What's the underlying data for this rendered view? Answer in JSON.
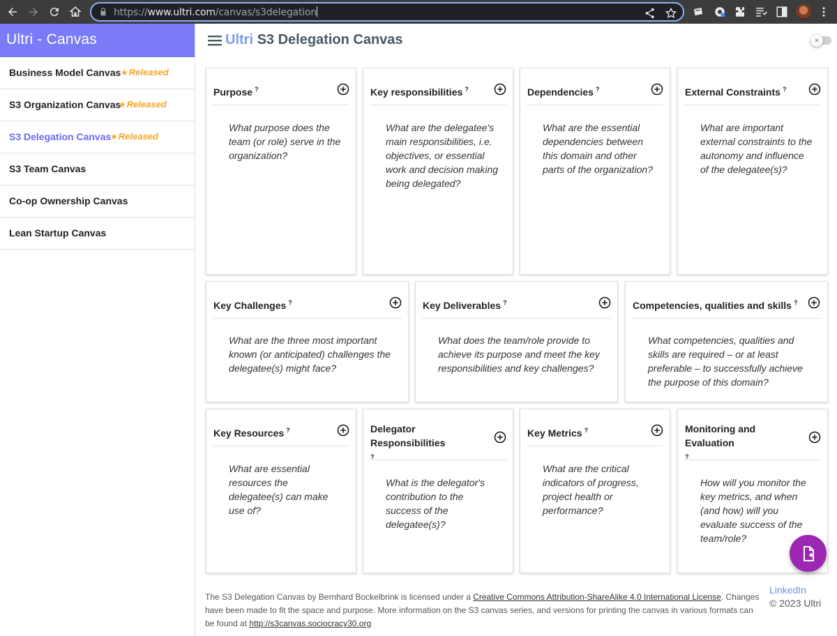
{
  "browser": {
    "url_scheme": "https://",
    "url_host": "www.ultri.com",
    "url_path": "/canvas/s3delegation"
  },
  "sidebar": {
    "title": "Ultri - Canvas",
    "items": [
      {
        "label": "Business Model Canvas",
        "badge": "Released"
      },
      {
        "label": "S3 Organization Canvas",
        "badge": "Released"
      },
      {
        "label": "S3 Delegation Canvas",
        "badge": "Released",
        "active": true
      },
      {
        "label": "S3 Team Canvas",
        "badge": ""
      },
      {
        "label": "Co-op Ownership Canvas",
        "badge": ""
      },
      {
        "label": "Lean Startup Canvas",
        "badge": ""
      }
    ]
  },
  "header": {
    "brand": "Ultri",
    "title": "S3 Delegation Canvas"
  },
  "cards": {
    "purpose": {
      "title": "Purpose",
      "hint": "?",
      "text": "What purpose does the team (or role) serve in the organization?"
    },
    "key_responsibilities": {
      "title": "Key responsibilities",
      "hint": "?",
      "text": "What are the delegatee's main responsibilities, i.e. objectives, or essential work and decision making being delegated?"
    },
    "dependencies": {
      "title": "Dependencies",
      "hint": "?",
      "text": "What are the essential dependencies between this domain and other parts of the organization?"
    },
    "external_constraints": {
      "title": "External Constraints",
      "hint": "?",
      "text": "What are important external constraints to the autonomy and influence of the delegatee(s)?"
    },
    "key_challenges": {
      "title": "Key Challenges",
      "hint": "?",
      "text": "What are the three most important known (or anticipated) challenges the delegatee(s) might face?"
    },
    "key_deliverables": {
      "title": "Key Deliverables",
      "hint": "?",
      "text": "What does the team/role provide to achieve its purpose and meet the key responsibilities and key challenges?"
    },
    "competencies": {
      "title": "Competencies, qualities and skills",
      "hint": "?",
      "text": "What competencies, qualities and skills are required – or at least preferable – to successfully achieve the purpose of this domain?"
    },
    "key_resources": {
      "title": "Key Resources",
      "hint": "?",
      "text": "What are essential resources the delegatee(s) can make use of?"
    },
    "delegator_responsibilities": {
      "title": "Delegator Responsibilities",
      "hint": "?",
      "text": "What is the delegator's contribution to the success of the delegatee(s)?"
    },
    "key_metrics": {
      "title": "Key Metrics",
      "hint": "?",
      "text": "What are the critical indicators of progress, project health or performance?"
    },
    "monitoring": {
      "title": "Monitoring and Evaluation",
      "hint": "?",
      "text": "How will you monitor the key metrics, and when (and how) will you evaluate success of the team/role?"
    }
  },
  "footer": {
    "text1": "The S3 Delegation Canvas by Bernhard Bockelbrink is licensed under a ",
    "license_link": "Creative Commons Attribution-ShareAlike 4.0 International License",
    "text2": ". Changes have been made to fit the space and purpose. More information on the S3 canvas series, and versions for printing the canvas in various formats can be found at ",
    "site_link": "http://s3canvas.sociocracy30.org",
    "linkedin": "LinkedIn",
    "copyright": "© 2023 Ultri"
  },
  "icons": {
    "accent": "#7b7bf7",
    "badge_color": "#f5a623",
    "fab_color": "#9c27b0"
  }
}
